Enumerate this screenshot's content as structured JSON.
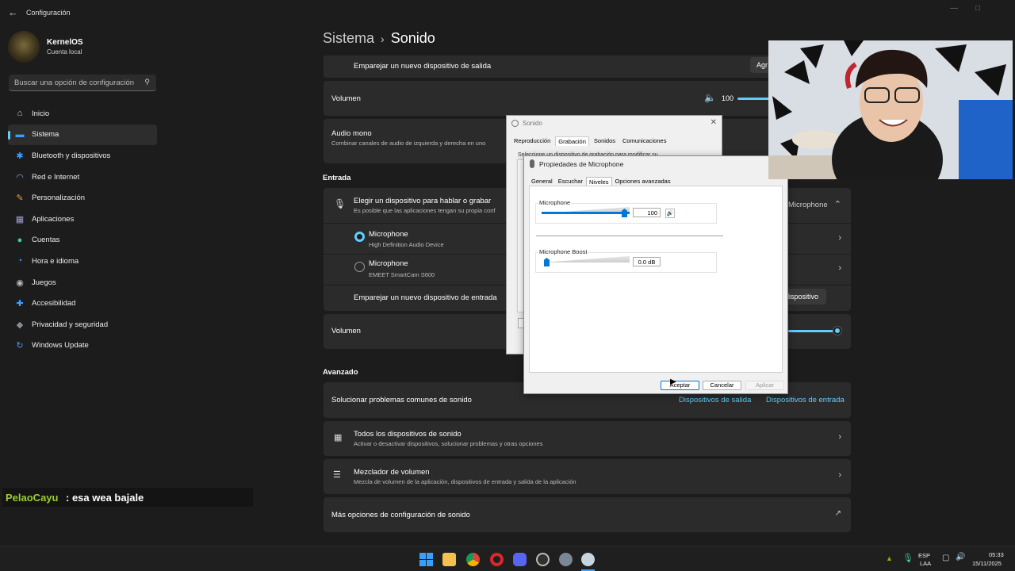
{
  "window": {
    "title": "Configuración",
    "back_icon": "back-arrow-icon"
  },
  "profile": {
    "name": "KernelOS",
    "subtitle": "Cuenta local"
  },
  "search": {
    "placeholder": "Buscar una opción de configuración"
  },
  "nav": [
    {
      "label": "Inicio",
      "icon": "home-icon",
      "color": "#d6d6d6"
    },
    {
      "label": "Sistema",
      "icon": "monitor-icon",
      "color": "#3aa0ff",
      "active": true
    },
    {
      "label": "Bluetooth y dispositivos",
      "icon": "bluetooth-icon",
      "color": "#3aa0ff"
    },
    {
      "label": "Red e Internet",
      "icon": "wifi-icon",
      "color": "#7ab0ff"
    },
    {
      "label": "Personalización",
      "icon": "brush-icon",
      "color": "#e69b45"
    },
    {
      "label": "Aplicaciones",
      "icon": "apps-icon",
      "color": "#a0a0d0"
    },
    {
      "label": "Cuentas",
      "icon": "account-icon",
      "color": "#3fcf8e"
    },
    {
      "label": "Hora e idioma",
      "icon": "globe-clock-icon",
      "color": "#3aa0ff"
    },
    {
      "label": "Juegos",
      "icon": "gamepad-icon",
      "color": "#bbbbbb"
    },
    {
      "label": "Accesibilidad",
      "icon": "accessibility-icon",
      "color": "#3aa0ff"
    },
    {
      "label": "Privacidad y seguridad",
      "icon": "shield-icon",
      "color": "#8a8a9a"
    },
    {
      "label": "Windows Update",
      "icon": "update-icon",
      "color": "#3aa0ff"
    }
  ],
  "breadcrumb": {
    "parent": "Sistema",
    "current": "Sonido"
  },
  "output": {
    "pair_label": "Emparejar un nuevo dispositivo de salida",
    "pair_button": "Agr",
    "volume_label": "Volumen",
    "volume_value": "100",
    "volume_level": 100,
    "mono_title": "Audio mono",
    "mono_sub": "Combinar canales de audio de izquierda y derecha en uno"
  },
  "input": {
    "section": "Entrada",
    "choose_title": "Elegir un dispositivo para hablar o grabar",
    "choose_sub": "Es posible que las aplicaciones tengan su propia conf",
    "selected_device": "Microphone",
    "devices": [
      {
        "name": "Microphone",
        "sub": "High Definition Audio Device",
        "selected": true
      },
      {
        "name": "Microphone",
        "sub": "EMEET SmartCam S600",
        "selected": false
      }
    ],
    "pair_label": "Emparejar un nuevo dispositivo de entrada",
    "pair_button": "dispositivo",
    "volume_label": "Volumen"
  },
  "advanced": {
    "section": "Avanzado",
    "troubleshoot": "Solucionar problemas comunes de sonido",
    "link_out": "Dispositivos de salida",
    "link_in": "Dispositivos de entrada",
    "all_title": "Todos los dispositivos de sonido",
    "all_sub": "Activar o desactivar dispositivos, solucionar problemas y otras opciones",
    "mixer_title": "Mezclador de volumen",
    "mixer_sub": "Mezcla de volumen de la aplicación, dispositivos de entrada y salida de la aplicación",
    "more": "Más opciones de configuración de sonido"
  },
  "dialog_sound": {
    "title": "Sonido",
    "tabs": [
      "Reproducción",
      "Grabación",
      "Sonidos",
      "Comunicaciones"
    ],
    "selected_tab": "Grabación",
    "desc": "Seleccione un dispositivo de grabación para modificar su"
  },
  "dialog_props": {
    "title": "Propiedades de Microphone",
    "tabs": [
      "General",
      "Escuchar",
      "Niveles",
      "Opciones avanzadas"
    ],
    "selected_tab": "Niveles",
    "mic_label": "Microphone",
    "mic_value": "100",
    "mic_level": 100,
    "boost_label": "Microphone Boost",
    "boost_value": "0.0 dB",
    "buttons": {
      "ok": "Aceptar",
      "cancel": "Cancelar",
      "apply": "Aplicar"
    }
  },
  "chat": {
    "user": "PelaoCayu",
    "message": ": esa wea bajale"
  },
  "taskbar": {
    "icons": [
      "windows-start-icon",
      "file-explorer-icon",
      "chrome-icon",
      "opera-icon",
      "discord-icon",
      "obs-icon",
      "settings-icon",
      "steam-icon"
    ],
    "lang_top": "ESP",
    "lang_bottom": "LAA",
    "time": "05:33",
    "date": "15/11/2025",
    "accent": "#3aa0ff"
  }
}
